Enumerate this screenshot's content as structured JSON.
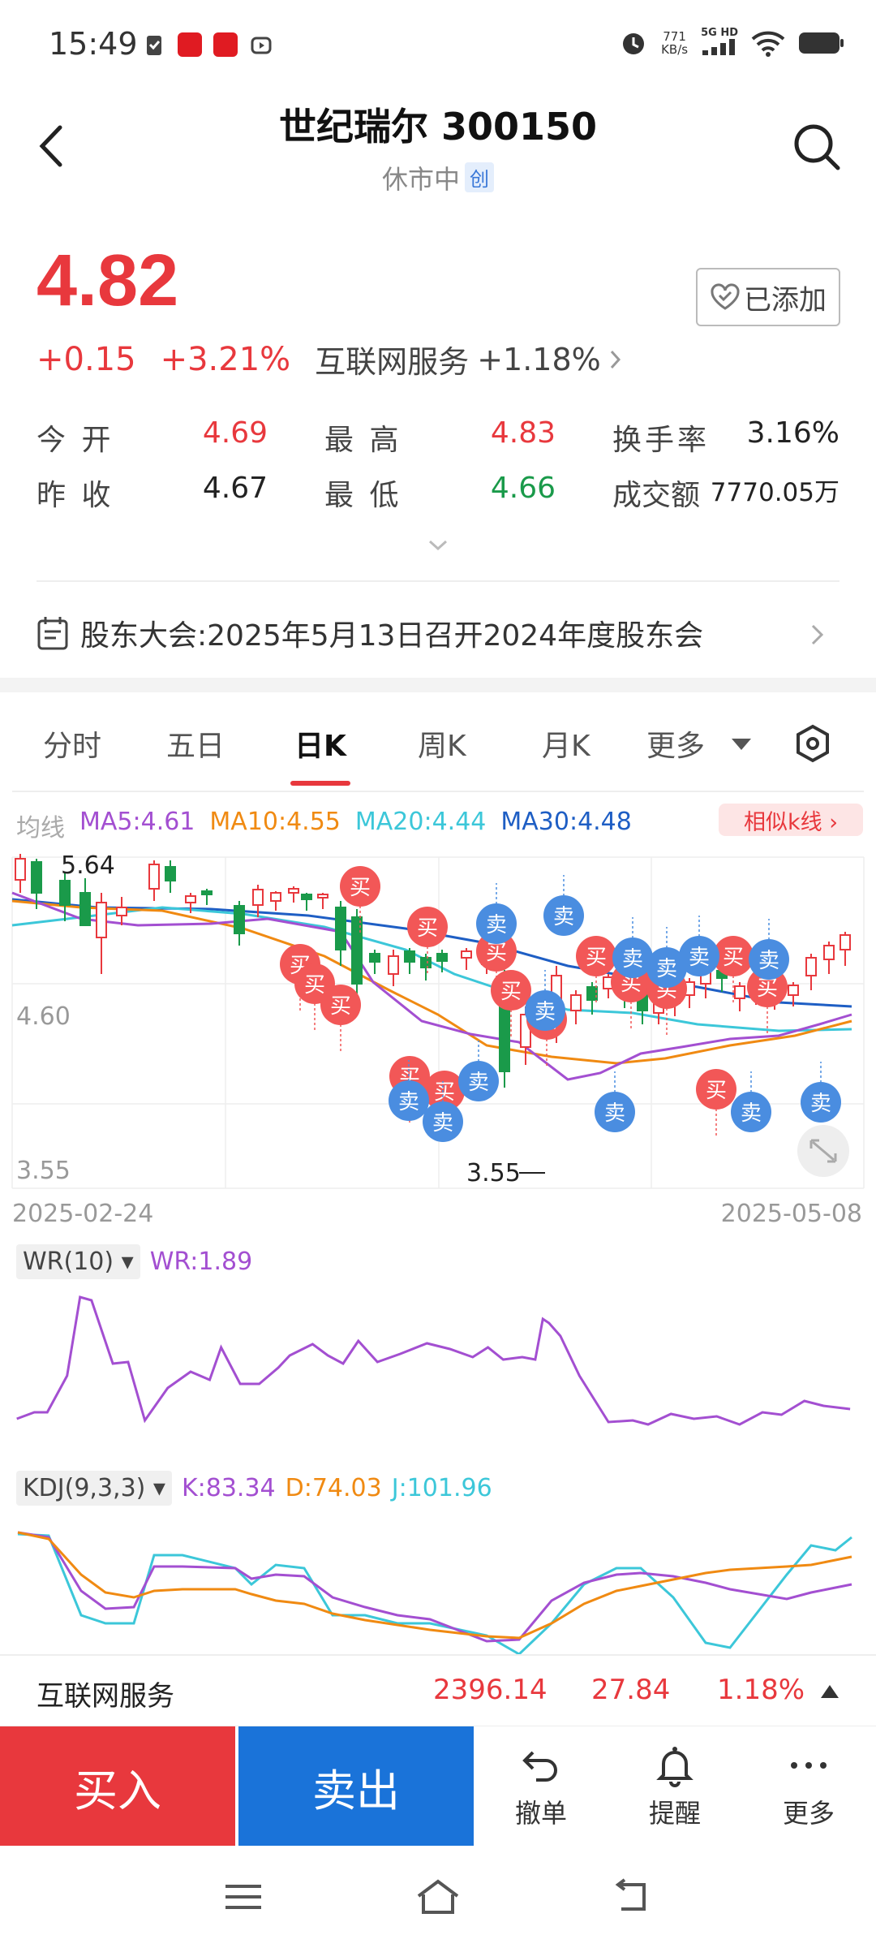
{
  "status": {
    "time": "15:49",
    "net_speed": "771",
    "net_speed_unit": "KB/s",
    "network": "5G HD"
  },
  "header": {
    "title": "世纪瑞尔 300150",
    "market_status": "休市中",
    "board_badge": "创"
  },
  "quote": {
    "price": "4.82",
    "change": "+0.15",
    "change_pct": "+3.21%",
    "industry": "互联网服务",
    "industry_pct": "+1.18%",
    "added_label": "已添加"
  },
  "stats": [
    [
      {
        "label": "今 开",
        "value": "4.69",
        "tone": "red"
      },
      {
        "label": "最 高",
        "value": "4.83",
        "tone": "red"
      },
      {
        "label": "换手率",
        "value": "3.16%",
        "tone": "dark"
      }
    ],
    [
      {
        "label": "昨 收",
        "value": "4.67",
        "tone": "dark"
      },
      {
        "label": "最 低",
        "value": "4.66",
        "tone": "green"
      },
      {
        "label": "成交额",
        "value": "7770.05万",
        "tone": "dark"
      }
    ]
  ],
  "notice": {
    "text": "股东大会:2025年5月13日召开2024年度股东会"
  },
  "tabs": [
    {
      "label": "分时",
      "active": false
    },
    {
      "label": "五日",
      "active": false
    },
    {
      "label": "日K",
      "active": true
    },
    {
      "label": "周K",
      "active": false
    },
    {
      "label": "月K",
      "active": false
    },
    {
      "label": "更多",
      "active": false
    }
  ],
  "ma": {
    "label": "均线",
    "ma5": "MA5:4.61",
    "ma10": "MA10:4.55",
    "ma20": "MA20:4.44",
    "ma30": "MA30:4.48",
    "similar": "相似k线 ›"
  },
  "chart": {
    "y_top": "5.64",
    "y_mid": "4.60",
    "y_bottom": "3.55",
    "low_mark": "3.55",
    "date_start": "2025-02-24",
    "date_end": "2025-05-08",
    "buy_label": "买",
    "sell_label": "卖"
  },
  "wr": {
    "selector": "WR(10) ▾",
    "value": "WR:1.89"
  },
  "kdj": {
    "selector": "KDJ(9,3,3) ▾",
    "k": "K:83.34",
    "d": "D:74.03",
    "j": "J:101.96"
  },
  "sector": {
    "name": "互联网服务",
    "index": "2396.14",
    "change": "27.84",
    "pct": "1.18%"
  },
  "actions": {
    "buy": "买入",
    "sell": "卖出",
    "cancel": "撤单",
    "alert": "提醒",
    "more": "更多"
  },
  "colors": {
    "up": "#e8383d",
    "down": "#1a9a4a",
    "sell": "#1a73d9",
    "ma5": "#a34fd1",
    "ma10": "#f08a12",
    "ma20": "#3cc7d9",
    "ma30": "#1e5ec4"
  }
}
